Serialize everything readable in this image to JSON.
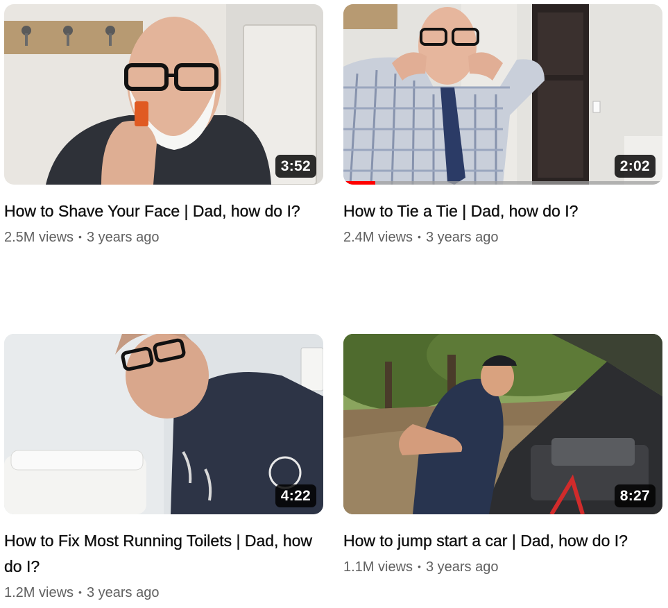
{
  "videos": [
    {
      "title": "How to Shave Your Face | Dad, how do I?",
      "duration": "3:52",
      "views": "2.5M views",
      "age": "3 years ago",
      "watched_fraction": 0
    },
    {
      "title": "How to Tie a Tie | Dad, how do I?",
      "duration": "2:02",
      "views": "2.4M views",
      "age": "3 years ago",
      "watched_fraction": 0.1
    },
    {
      "title": "How to Fix Most Running Toilets | Dad, how do I?",
      "duration": "4:22",
      "views": "1.2M views",
      "age": "3 years ago",
      "watched_fraction": 0
    },
    {
      "title": "How to jump start a car | Dad, how do I?",
      "duration": "8:27",
      "views": "1.1M views",
      "age": "3 years ago",
      "watched_fraction": 0
    }
  ],
  "meta_separator": "•",
  "colors": {
    "progress": "#ff0000",
    "meta_text": "#606060",
    "title_text": "#0f0f0f"
  }
}
